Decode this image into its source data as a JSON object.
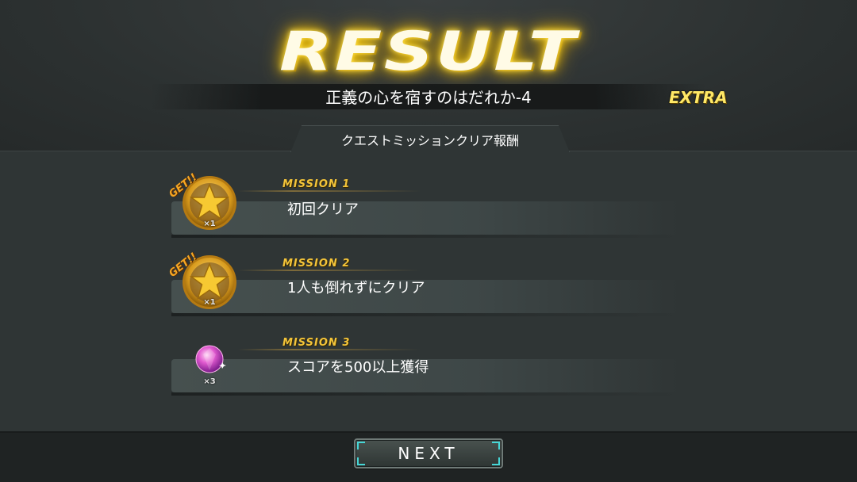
{
  "header": {
    "title": "RESULT",
    "quest_name": "正義の心を宿すのはだれか-4",
    "difficulty": "EXTRA"
  },
  "tab": {
    "label": "クエストミッションクリア報酬"
  },
  "missions": [
    {
      "label": "MISSION 1",
      "description": "初回クリア",
      "reward_icon": "star-medal-icon",
      "get_badge": "GET!!",
      "quantity": "×1"
    },
    {
      "label": "MISSION 2",
      "description": "1人も倒れずにクリア",
      "reward_icon": "star-medal-icon",
      "get_badge": "GET!!",
      "quantity": "×1"
    },
    {
      "label": "MISSION 3",
      "description": "スコアを500以上獲得",
      "reward_icon": "pink-gem-icon",
      "get_badge": "",
      "quantity": "×3"
    }
  ],
  "footer": {
    "next_label": "NEXT"
  },
  "colors": {
    "background": "#2b3030",
    "title_glow": "#f5c400",
    "mission_label": "#f3c43a",
    "accent_cyan": "#46d6d6"
  }
}
